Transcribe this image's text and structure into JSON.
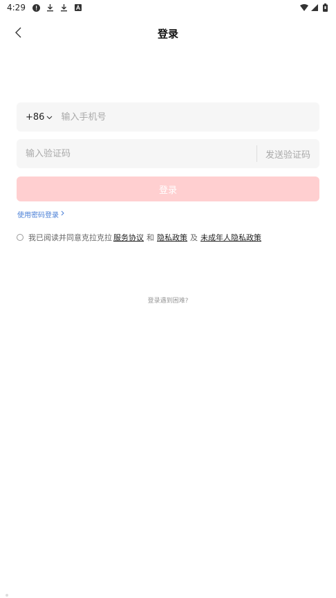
{
  "status_bar": {
    "time": "4:29",
    "icons": [
      "alert-icon",
      "download-icon",
      "download-icon",
      "app-a-icon",
      "wifi-icon",
      "signal-icon",
      "battery-icon"
    ]
  },
  "header": {
    "title": "登录",
    "back_icon": "chevron-left-icon"
  },
  "phone_field": {
    "country_code": "+86",
    "placeholder": "输入手机号",
    "value": ""
  },
  "code_field": {
    "placeholder": "输入验证码",
    "value": "",
    "send_code_label": "发送验证码"
  },
  "login_button": {
    "label": "登录",
    "color": "#ffcfd0"
  },
  "password_login": {
    "label": "使用密码登录",
    "arrow": "chevron-right-icon",
    "color": "#4a7fd6"
  },
  "agreement": {
    "prefix": "我已阅读并同意克拉克拉",
    "service_agreement": "服务协议",
    "and": "和",
    "privacy_policy": "隐私政策",
    "and2": "及",
    "minor_privacy_policy": "未成年人隐私政策"
  },
  "trouble": {
    "label": "登录遇到困难?"
  }
}
